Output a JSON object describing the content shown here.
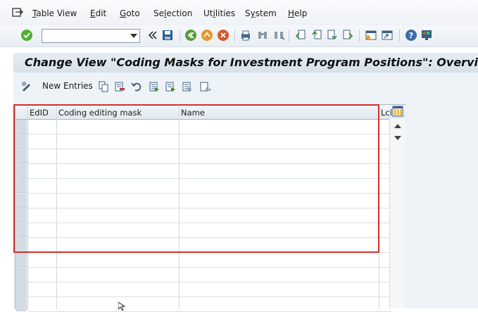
{
  "menubar": {
    "items": [
      {
        "label": "Table View",
        "key": "T"
      },
      {
        "label": "Edit",
        "key": "E"
      },
      {
        "label": "Goto",
        "key": "G"
      },
      {
        "label": "Selection",
        "key": "l"
      },
      {
        "label": "Utilities",
        "key": "i"
      },
      {
        "label": "System",
        "key": "y"
      },
      {
        "label": "Help",
        "key": "H"
      }
    ]
  },
  "toolbar": {
    "command_value": "",
    "command_placeholder": "",
    "icons": [
      "enter-icon",
      "back-double-arrow-icon",
      "save-icon",
      "back-icon",
      "exit-icon",
      "cancel-icon",
      "print-icon",
      "find-icon",
      "find-next-icon",
      "first-page-icon",
      "previous-page-icon",
      "next-page-icon",
      "last-page-icon",
      "create-session-icon",
      "shortcut-icon",
      "help-icon",
      "customize-layout-icon"
    ]
  },
  "title": "Change View \"Coding Masks for Investment Program Positions\": Overview",
  "app_toolbar": {
    "new_entries_label": "New Entries"
  },
  "table": {
    "columns": [
      "EdID",
      "Coding editing mask",
      "Name",
      "Lcl"
    ],
    "row_count": 13
  },
  "colors": {
    "highlight": "#d0312d",
    "title_bg": "#dce6ef",
    "enter_green": "#4caf2e"
  }
}
